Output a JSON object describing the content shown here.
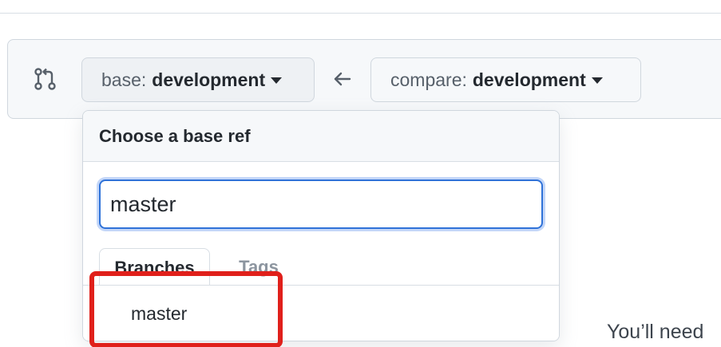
{
  "compare": {
    "base_prefix": "base:",
    "base_ref": "development",
    "compare_prefix": "compare:",
    "compare_ref": "development",
    "icons": {
      "pull_request": "git-pull-request-icon",
      "arrow": "arrow-left-icon",
      "caret": "triangle-down-icon"
    }
  },
  "dropdown": {
    "title": "Choose a base ref",
    "filter_value": "master",
    "tabs": [
      {
        "label": "Branches",
        "active": true
      },
      {
        "label": "Tags",
        "active": false
      }
    ],
    "items": [
      "master"
    ]
  },
  "trailing_text": "You’ll need",
  "colors": {
    "focus_ring": "#2f72d8",
    "annotation": "#e0201b"
  }
}
